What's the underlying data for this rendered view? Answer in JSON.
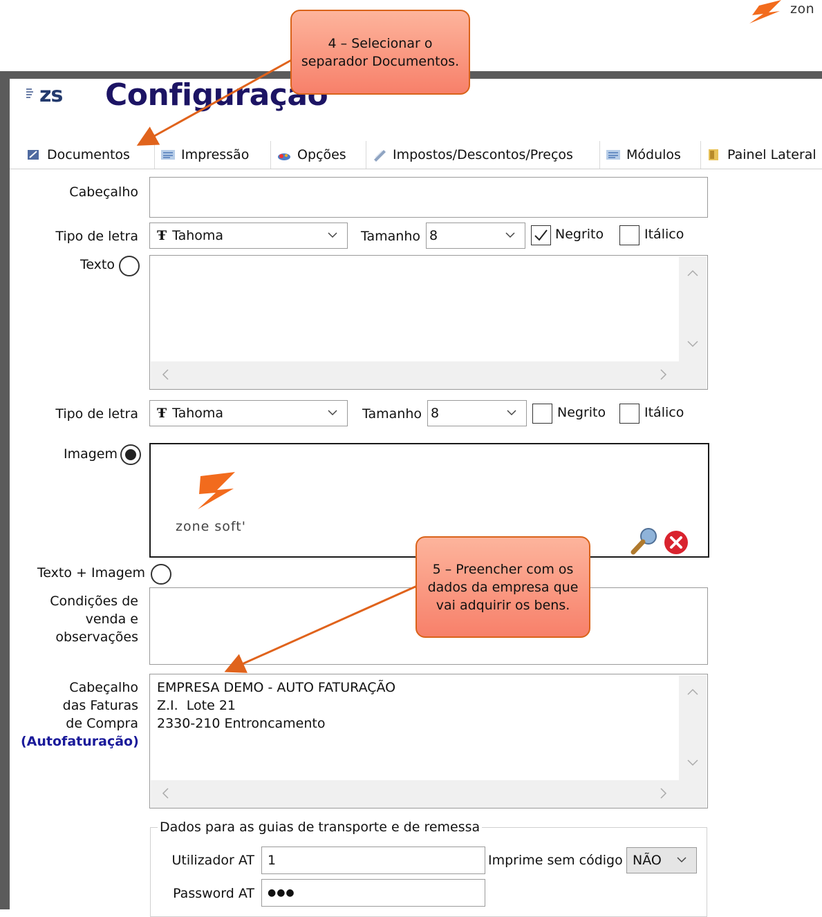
{
  "brand": {
    "text": "zon",
    "accent": "#f26b1d"
  },
  "window": {
    "logo_text": "zs",
    "title": "Configuração"
  },
  "tabs": [
    {
      "label": "Documentos",
      "icon": "documents-icon",
      "active": true
    },
    {
      "label": "Impressão",
      "icon": "print-settings-icon"
    },
    {
      "label": "Opções",
      "icon": "options-icon"
    },
    {
      "label": "Impostos/Descontos/Preços",
      "icon": "taxes-icon"
    },
    {
      "label": "Módulos",
      "icon": "modules-icon"
    },
    {
      "label": "Painel Lateral",
      "icon": "side-panel-icon"
    }
  ],
  "form": {
    "cabecalho_label": "Cabeçalho",
    "cabecalho_value": "",
    "font_row1": {
      "font_label": "Tipo de letra",
      "font_value": "Tahoma",
      "size_label": "Tamanho",
      "size_value": "8",
      "bold_label": "Negrito",
      "bold_checked": true,
      "italic_label": "Itálico",
      "italic_checked": false
    },
    "texto_label": "Texto",
    "texto_value": "",
    "font_row2": {
      "font_label": "Tipo de letra",
      "font_value": "Tahoma",
      "size_label": "Tamanho",
      "size_value": "8",
      "bold_label": "Negrito",
      "bold_checked": false,
      "italic_label": "Itálico",
      "italic_checked": false
    },
    "imagem_label": "Imagem",
    "image_logo_text": "zone soft'",
    "texto_imagem_label": "Texto + Imagem",
    "condicoes_label_lines": [
      "Condições de",
      "venda e",
      "observações"
    ],
    "condicoes_value": "",
    "faturas_label_lines": [
      "Cabeçalho",
      "das Faturas",
      "de Compra"
    ],
    "faturas_label_highlight": "(Autofaturação)",
    "faturas_value_lines": [
      "EMPRESA DEMO - AUTO FATURAÇÃO",
      "Z.I.  Lote 21",
      "2330-210 Entroncamento"
    ],
    "transport": {
      "title": "Dados para as guias de transporte e de remessa",
      "user_label": "Utilizador AT",
      "user_value": "1",
      "print_label": "Imprime sem código",
      "print_value": "NÃO",
      "password_label": "Password AT",
      "password_value": "●●●"
    }
  },
  "callouts": [
    {
      "text": "4 – Selecionar o separador Documentos."
    },
    {
      "text": "5 – Preencher com os dados da empresa que vai adquirir os bens."
    }
  ]
}
